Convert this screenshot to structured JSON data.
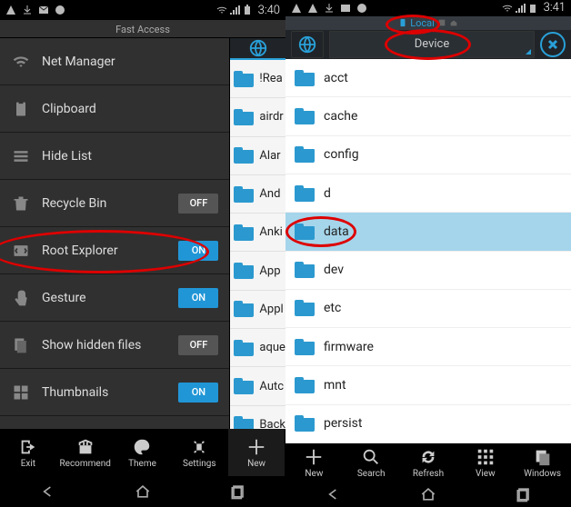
{
  "left": {
    "status_time": "3:40",
    "fast_access_title": "Fast Access",
    "items": [
      {
        "icon": "wifi",
        "label": "Net Manager",
        "toggle": null
      },
      {
        "icon": "clipboard",
        "label": "Clipboard",
        "toggle": null
      },
      {
        "icon": "eye-off",
        "label": "Hide List",
        "toggle": null
      },
      {
        "icon": "trash",
        "label": "Recycle Bin",
        "toggle": "OFF"
      },
      {
        "icon": "root",
        "label": "Root Explorer",
        "toggle": "ON"
      },
      {
        "icon": "gesture",
        "label": "Gesture",
        "toggle": "ON"
      },
      {
        "icon": "hidden",
        "label": "Show hidden files",
        "toggle": "OFF"
      },
      {
        "icon": "thumbs",
        "label": "Thumbnails",
        "toggle": "ON"
      }
    ],
    "partial_folders": [
      "!Rea",
      "airdr",
      "Alar",
      "And",
      "Anki",
      "App",
      "Appl",
      "aque",
      "Autc",
      "Back"
    ],
    "bottom": {
      "exit": "Exit",
      "recommend": "Recommend",
      "theme": "Theme",
      "settings": "Settings",
      "new": "New"
    }
  },
  "right": {
    "status_time": "3:41",
    "breadcrumb": "Local",
    "dropdown_label": "Device",
    "folders": [
      "acct",
      "cache",
      "config",
      "d",
      "data",
      "dev",
      "etc",
      "firmware",
      "mnt",
      "persist"
    ],
    "selected_index": 4,
    "bottom": {
      "new": "New",
      "search": "Search",
      "refresh": "Refresh",
      "view": "View",
      "windows": "Windows"
    }
  },
  "annotations": {
    "root_explorer_row": true,
    "local_breadcrumb": true,
    "device_dropdown": true,
    "data_folder": true
  }
}
